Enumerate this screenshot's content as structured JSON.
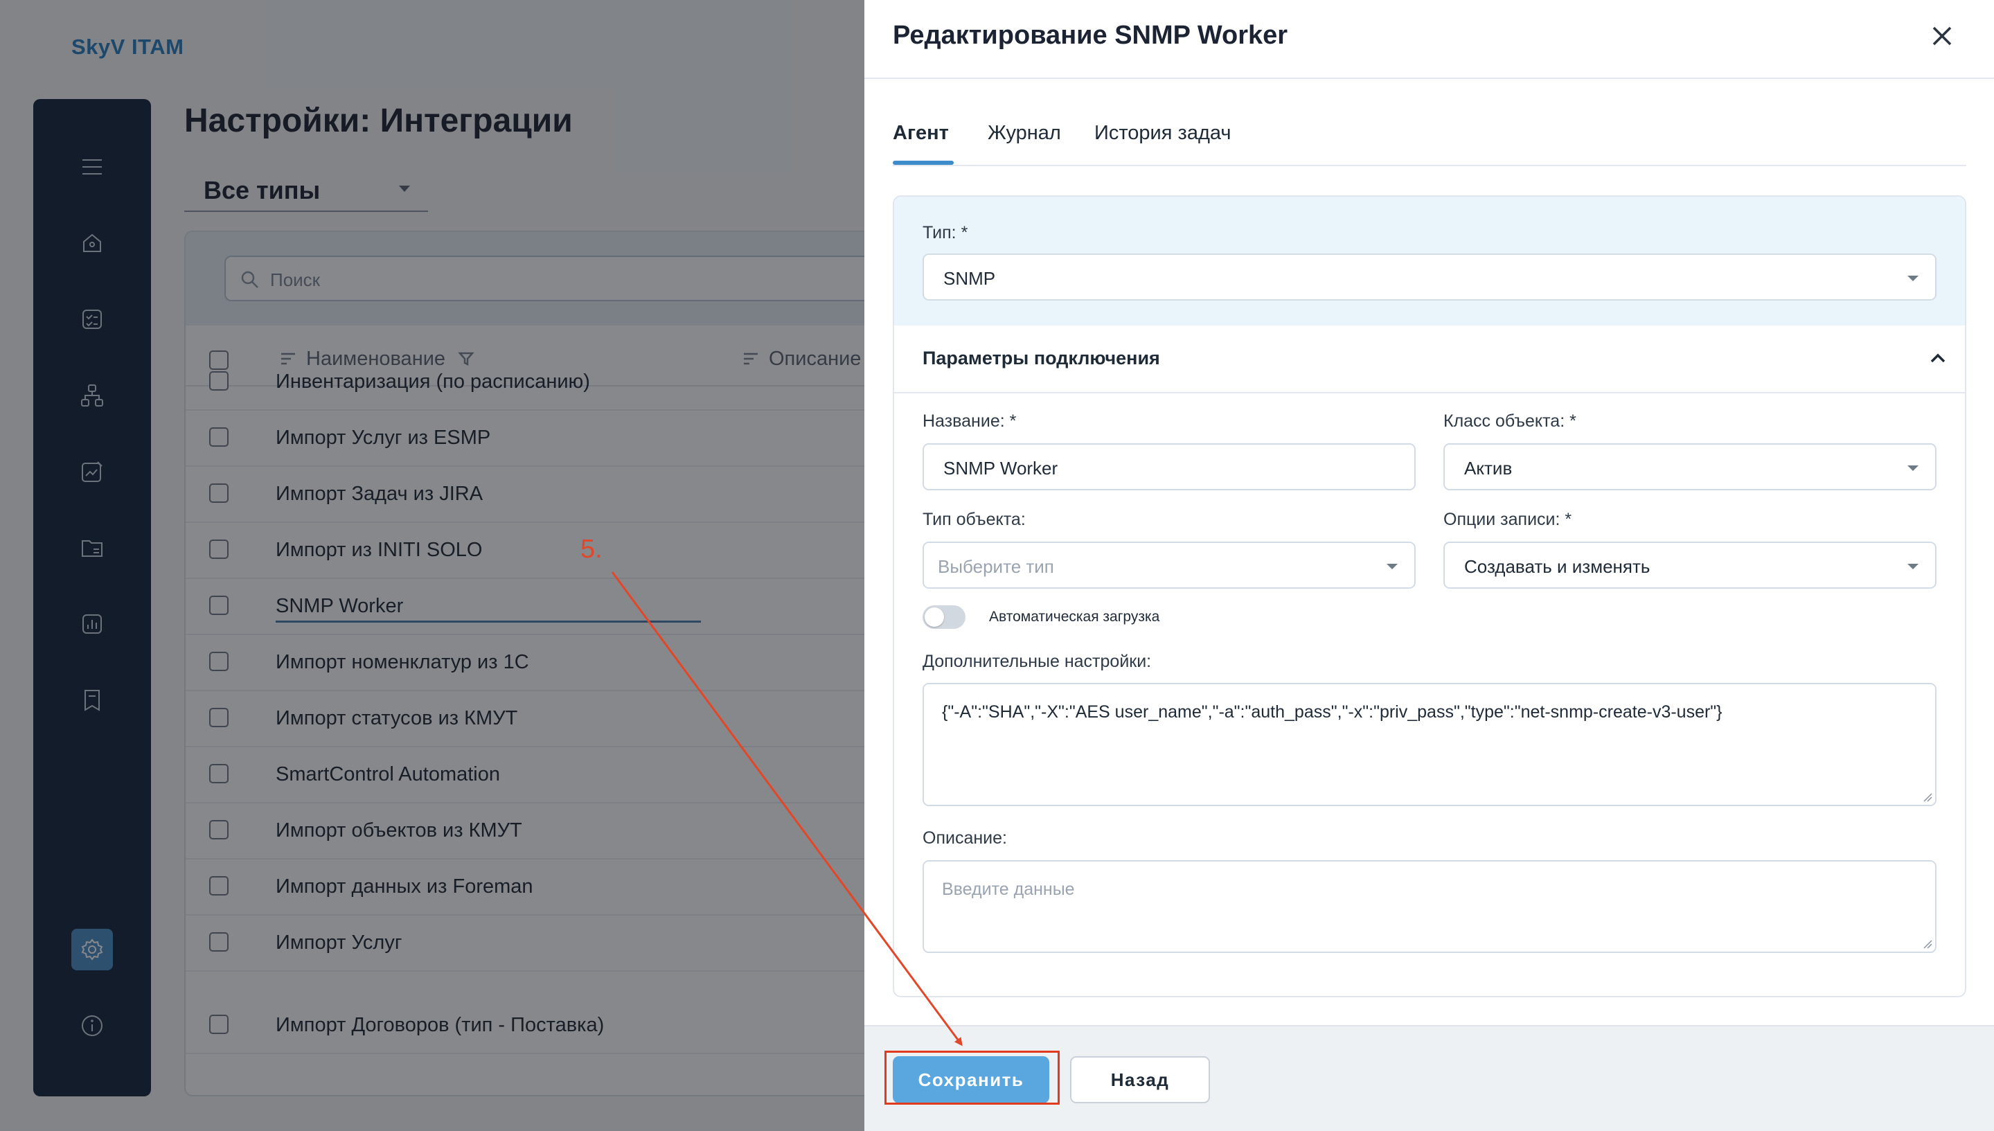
{
  "app": {
    "logo": "SkyV ITAM"
  },
  "page": {
    "title": "Настройки: Интеграции",
    "type_filter": "Все типы",
    "search_placeholder": "Поиск",
    "columns": [
      "Наименование",
      "Описание"
    ],
    "rows": [
      "Инвентаризация (по расписанию)",
      "Импорт Услуг из ESMP",
      "Импорт Задач из JIRA",
      "Импорт из INITI SOLO",
      "SNMP Worker",
      "Импорт номенклатур из 1С",
      "Импорт статусов из КМУТ",
      "SmartControl Automation",
      "Импорт объектов из КМУТ",
      "Импорт данных из Foreman",
      "Импорт Услуг",
      "Импорт Договоров (тип - Поставка)"
    ]
  },
  "sidebar": {
    "icons": [
      "menu-icon",
      "home-icon",
      "tasks-icon",
      "network-icon",
      "edit-chart-icon",
      "folder-icon",
      "reports-icon",
      "bookmark-icon",
      "settings-icon",
      "info-icon"
    ],
    "active": "settings-icon"
  },
  "drawer": {
    "title": "Редактирование SNMP Worker",
    "tabs": [
      {
        "label": "Агент",
        "active": true
      },
      {
        "label": "Журнал",
        "active": false
      },
      {
        "label": "История задач",
        "active": false
      }
    ],
    "type": {
      "label": "Тип: *",
      "value": "SNMP"
    },
    "section_title": "Параметры подключения",
    "fields": {
      "name": {
        "label": "Название: *",
        "value": "SNMP Worker"
      },
      "object_class": {
        "label": "Класс объекта: *",
        "value": "Актив"
      },
      "object_type": {
        "label": "Тип объекта:",
        "placeholder": "Выберите тип"
      },
      "write_options": {
        "label": "Опции записи: *",
        "value": "Создавать и изменять"
      },
      "auto_load": {
        "label": "Автоматическая загрузка",
        "enabled": false
      },
      "extra_settings": {
        "label": "Дополнительные настройки:",
        "value": "{\"-A\":\"SHA\",\"-X\":\"AES user_name\",\"-a\":\"auth_pass\",\"-x\":\"priv_pass\",\"type\":\"net-snmp-create-v3-user\"}"
      },
      "description": {
        "label": "Описание:",
        "placeholder": "Введите данные"
      }
    },
    "buttons": {
      "save": "Сохранить",
      "back": "Назад"
    }
  },
  "annotation": {
    "step": "5.",
    "color": "#e2472a"
  },
  "colors": {
    "sidebar": "#16263c",
    "accent": "#3d8ccc",
    "save_button": "#5aa7df",
    "highlight": "#e23a1e"
  }
}
